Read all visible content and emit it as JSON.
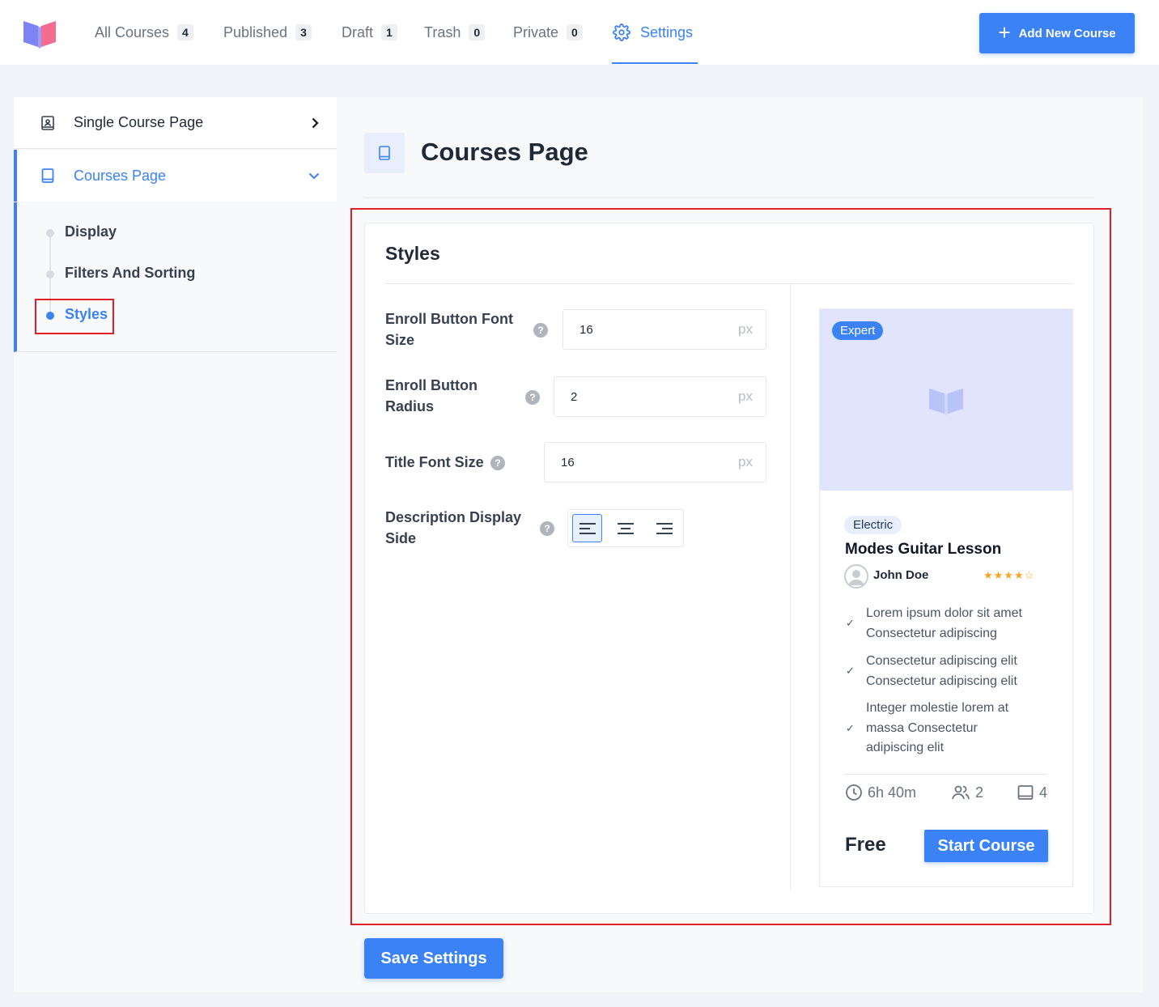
{
  "nav": {
    "tabs": [
      {
        "label": "All Courses",
        "count": "4"
      },
      {
        "label": "Published",
        "count": "3"
      },
      {
        "label": "Draft",
        "count": "1"
      },
      {
        "label": "Trash",
        "count": "0"
      },
      {
        "label": "Private",
        "count": "0"
      },
      {
        "label": "Settings",
        "icon": "gear-icon"
      }
    ],
    "active_tab": "Settings",
    "add_button_label": "Add New Course"
  },
  "sidebar": {
    "items": [
      {
        "label": "Single Course Page",
        "icon": "profile-book-icon",
        "state": "collapsed"
      },
      {
        "label": "Courses Page",
        "icon": "book-icon",
        "state": "expanded"
      }
    ],
    "sub_items": [
      {
        "label": "Display"
      },
      {
        "label": "Filters And Sorting"
      },
      {
        "label": "Styles"
      }
    ],
    "active_sub_item": "Styles"
  },
  "page": {
    "title": "Courses Page"
  },
  "styles_panel": {
    "title": "Styles",
    "fields": {
      "enroll_font_size": {
        "label": "Enroll Button Font Size",
        "value": "16",
        "unit": "px"
      },
      "enroll_radius": {
        "label": "Enroll Button Radius",
        "value": "2",
        "unit": "px"
      },
      "title_font_size": {
        "label": "Title Font Size",
        "value": "16",
        "unit": "px"
      },
      "description_side": {
        "label": "Description Display Side",
        "options": [
          "left",
          "center",
          "right"
        ],
        "selected": "left"
      }
    },
    "help_glyph": "?"
  },
  "preview": {
    "level": "Expert",
    "category": "Electric",
    "course_title": "Modes Guitar Lesson",
    "author": "John Doe",
    "rating": 4,
    "stars": "★★★★☆",
    "features": [
      "Lorem ipsum dolor sit amet Consectetur adipiscing",
      "Consectetur adipiscing elit Consectetur adipiscing elit",
      "Integer molestie lorem at massa Consectetur adipiscing elit"
    ],
    "duration": "6h 40m",
    "students": "2",
    "lessons": "4",
    "price": "Free",
    "cta_label": "Start Course"
  },
  "footer": {
    "save_label": "Save Settings"
  },
  "colors": {
    "accent": "#3b82f6",
    "highlight_outline": "#e11d2a",
    "thumb_bg": "#e0e5fd",
    "star": "#f5a623"
  }
}
